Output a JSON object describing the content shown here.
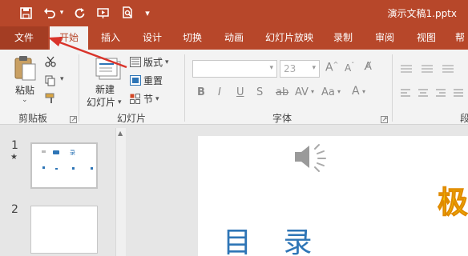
{
  "app": {
    "doc_title": "演示文稿1.pptx"
  },
  "qat": {
    "save_icon": "save-icon",
    "undo_icon": "undo-icon",
    "redo_icon": "redo-icon",
    "present_icon": "present-from-start-icon",
    "preview_icon": "print-preview-icon",
    "customize_icon": "customize-qat-icon"
  },
  "tabs": [
    "文件",
    "开始",
    "插入",
    "设计",
    "切换",
    "动画",
    "幻灯片放映",
    "录制",
    "审阅",
    "视图",
    "帮"
  ],
  "clipboard": {
    "paste_label": "粘贴",
    "group_label": "剪贴板"
  },
  "slides_group": {
    "new_slide_label_1": "新建",
    "new_slide_label_2": "幻灯片",
    "layout_label": "版式",
    "reset_label": "重置",
    "section_label": "节",
    "group_label": "幻灯片"
  },
  "font_group": {
    "font_name": "",
    "font_size": "23",
    "group_label": "字体",
    "bold": "B",
    "italic": "I",
    "underline": "U",
    "strike": "S",
    "case": "Aa"
  },
  "para_group": {
    "group_label": "段"
  },
  "thumbnails": [
    {
      "number": "1",
      "star": "★",
      "title": "目 录"
    },
    {
      "number": "2",
      "star": "",
      "title": ""
    }
  ],
  "slide": {
    "title": "目 录",
    "partial_title": "极"
  },
  "colors": {
    "accent": "#b7472a",
    "title_blue": "#2e75b6",
    "arrow_red": "#d9342b"
  }
}
